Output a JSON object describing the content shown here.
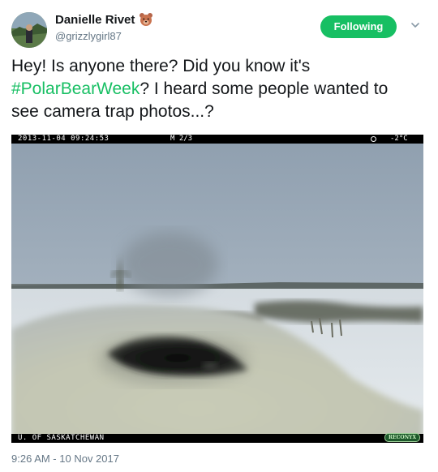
{
  "author": {
    "display_name": "Danielle Rivet",
    "handle": "@grizzlygirl87",
    "badge_icon": "bear-face-icon"
  },
  "follow_button": {
    "label": "Following",
    "color": "#17bf63"
  },
  "caret_icon": "chevron-down-icon",
  "tweet": {
    "text_before": "Hey! Is anyone there? Did you know it's ",
    "hashtag": "#PolarBearWeek",
    "text_after": "? I heard some people wanted to see camera trap photos...?"
  },
  "photo": {
    "overlay_timestamp": "2013-11-04 09:24:53",
    "overlay_mode": "M 2/3",
    "overlay_temperature": "-2°C",
    "overlay_credit": "U. OF SASKATCHEWAN",
    "brand_logo": "RECONYX"
  },
  "timestamp": "9:26 AM - 10 Nov 2017",
  "colors": {
    "hashtag": "#17bf63",
    "secondary_text": "#657786"
  }
}
